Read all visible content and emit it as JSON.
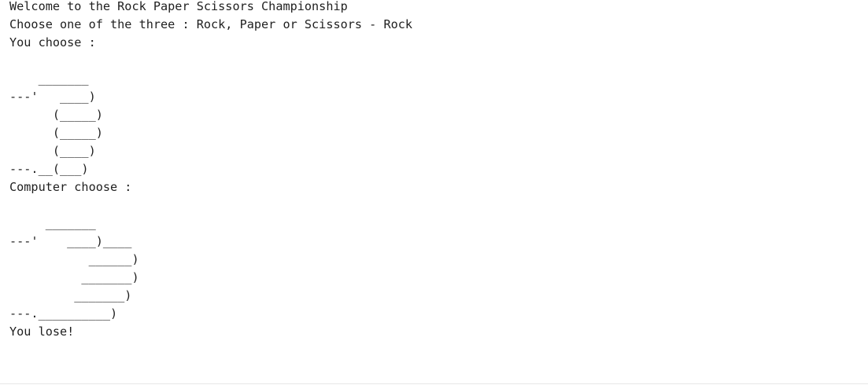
{
  "console": {
    "welcome": "Welcome to the Rock Paper Scissors Championship",
    "prompt": "Choose one of the three : Rock, Paper or Scissors - Rock",
    "user_header": "You choose :",
    "user_art": "\n    _______\n---'   ____)\n      (_____)\n      (_____)\n      (____)\n---.__(___)\n",
    "computer_header": "Computer choose :",
    "computer_art": "\n     _______\n---'    ____)____\n           ______)\n          _______)\n         _______)\n---.__________)\n",
    "result": "You lose!"
  }
}
